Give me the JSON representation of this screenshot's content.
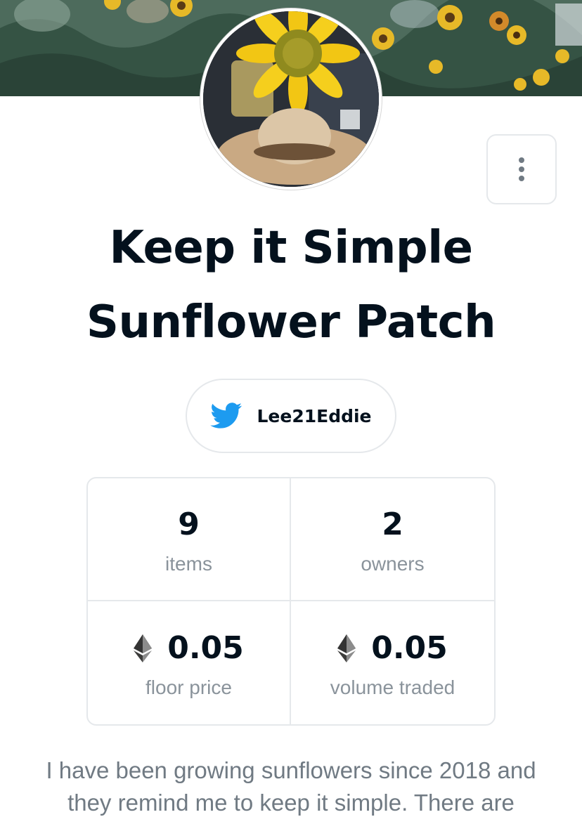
{
  "collection": {
    "name": "Keep it Simple Sunflower Patch",
    "twitter_handle": "Lee21Eddie",
    "description": "I have been growing sunflowers since 2018 and they remind me to keep it simple. There are"
  },
  "stats": [
    {
      "value": "9",
      "label": "items",
      "currency_icon": null
    },
    {
      "value": "2",
      "label": "owners",
      "currency_icon": null
    },
    {
      "value": "0.05",
      "label": "floor price",
      "currency_icon": "ethereum-icon"
    },
    {
      "value": "0.05",
      "label": "volume traded",
      "currency_icon": "ethereum-icon"
    }
  ],
  "icons": {
    "more": "more-vertical-icon",
    "twitter": "twitter-bird-icon",
    "currency": "ethereum-icon"
  },
  "colors": {
    "text_primary": "#04111d",
    "text_secondary": "#707a83",
    "border": "#e5e8eb",
    "twitter_blue": "#1d9bf0"
  }
}
